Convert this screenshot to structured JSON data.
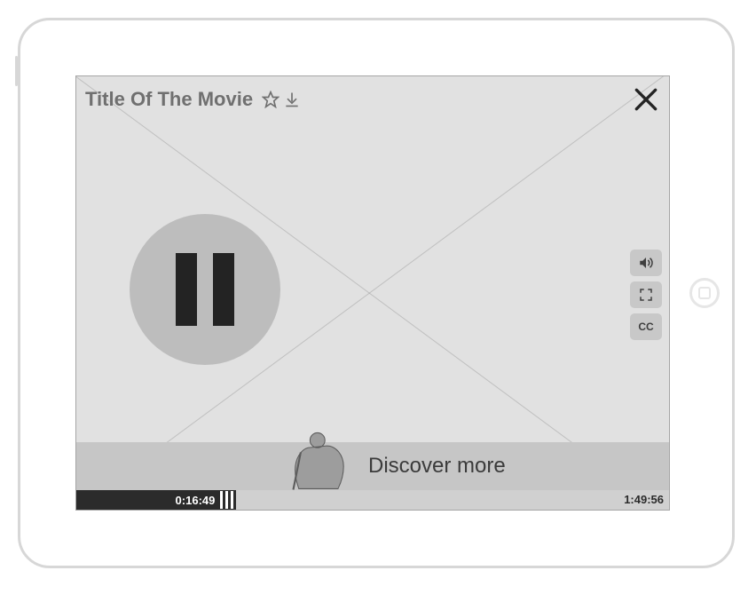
{
  "movie_title": "Title Of The Movie",
  "banner": {
    "label": "Discover more"
  },
  "playback": {
    "elapsed": "0:16:49",
    "total": "1:49:56"
  },
  "controls": {
    "cc_label": "CC"
  }
}
